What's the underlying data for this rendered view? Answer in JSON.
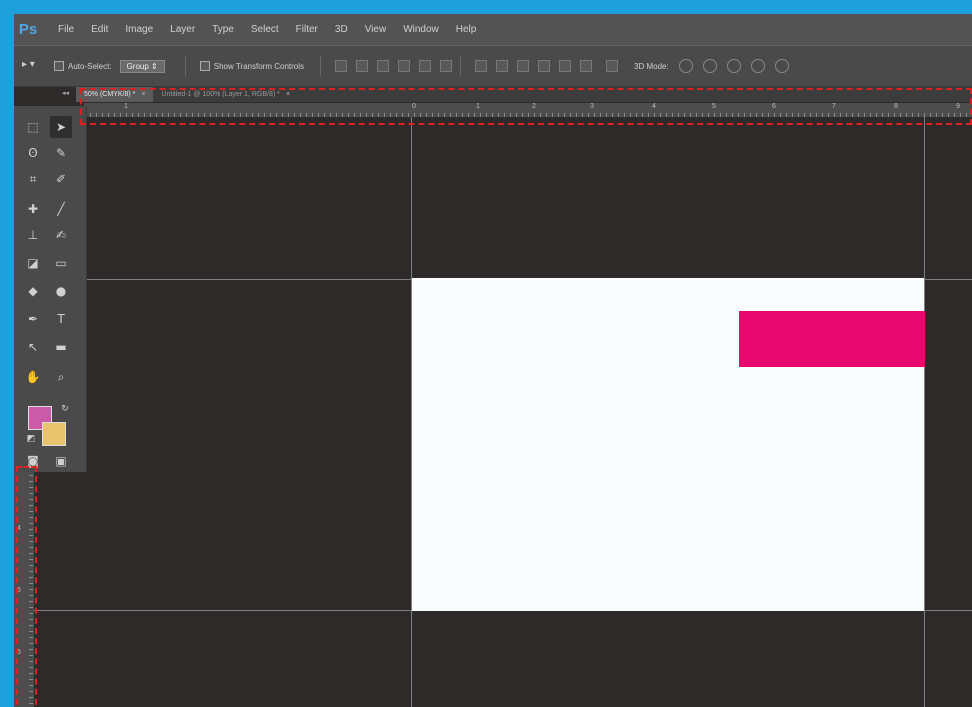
{
  "app": {
    "logo": "Ps"
  },
  "menu": [
    "File",
    "Edit",
    "Image",
    "Layer",
    "Type",
    "Select",
    "Filter",
    "3D",
    "View",
    "Window",
    "Help"
  ],
  "options_bar": {
    "auto_select_label": "Auto-Select:",
    "group_value": "Group",
    "show_transform_label": "Show Transform Controls",
    "mode_label": "3D Mode:"
  },
  "tabs": [
    {
      "label": "50% (CMYK/8) *",
      "close": "×",
      "active": true
    },
    {
      "label": "Untitled-1 @ 100% (Layer 1, RGB/8) *",
      "close": "×",
      "active": false
    }
  ],
  "ruler": {
    "h_ticks": [
      "1",
      "0",
      "1",
      "2",
      "3",
      "4",
      "5",
      "6",
      "7",
      "8",
      "9"
    ],
    "v_ticks": [
      "4",
      "5",
      "6"
    ]
  },
  "colors": {
    "foreground": "#cb5aa9",
    "background": "#e8c46e",
    "pink_rect": "#e8096f",
    "annotation": "#e02020",
    "frame": "#1ea0dc"
  },
  "tools": [
    "marquee-tool",
    "move-tool",
    "lasso-tool",
    "quick-selection-tool",
    "crop-tool",
    "eyedropper-tool",
    "spot-healing-tool",
    "brush-tool",
    "clone-stamp-tool",
    "history-brush-tool",
    "eraser-tool",
    "gradient-tool",
    "blur-tool",
    "dodge-tool",
    "pen-tool",
    "type-tool",
    "path-selection-tool",
    "shape-tool",
    "hand-tool",
    "zoom-tool",
    "quick-mask-tool",
    "screen-mode-tool"
  ]
}
